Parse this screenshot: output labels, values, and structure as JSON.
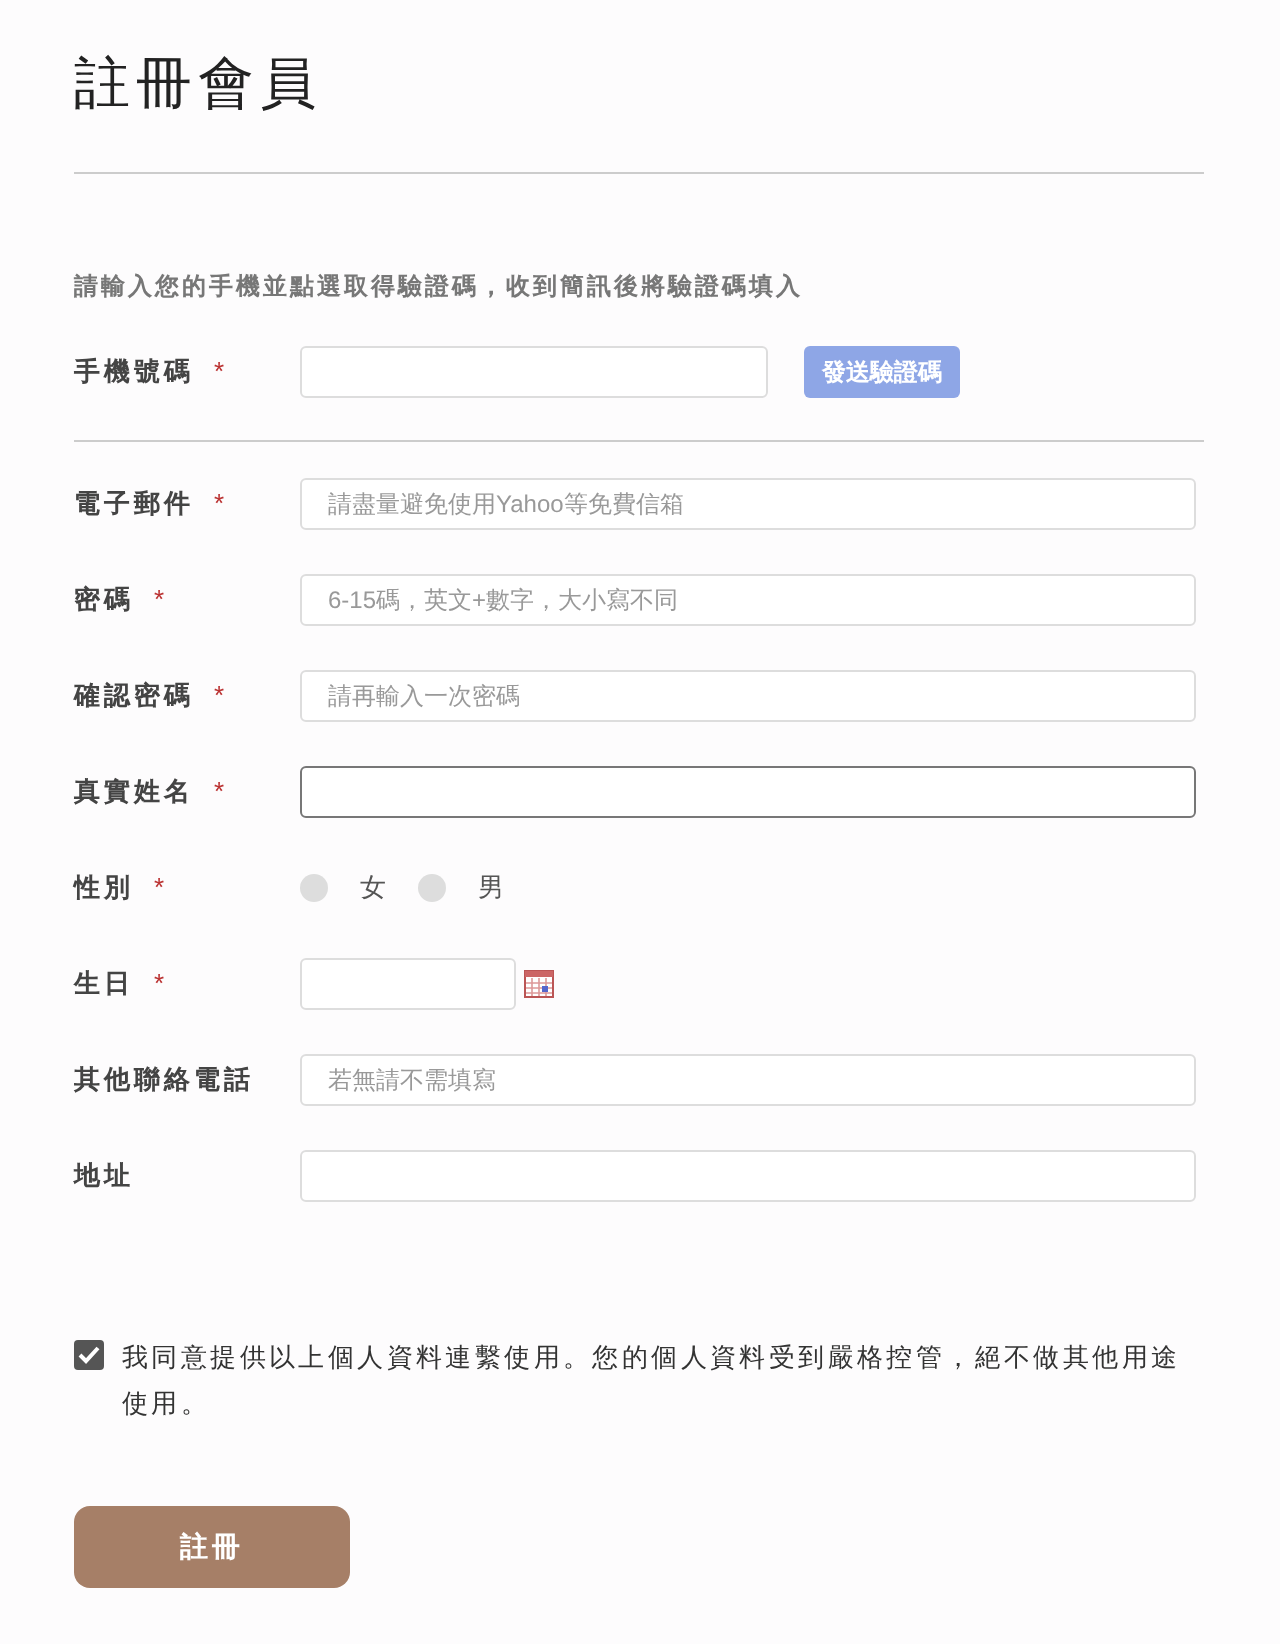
{
  "title": "註冊會員",
  "intro": "請輸入您的手機並點選取得驗證碼，收到簡訊後將驗證碼填入",
  "phone": {
    "label": "手機號碼",
    "mark": "*",
    "button": "發送驗證碼",
    "button_disabled": true
  },
  "fields": [
    {
      "kind": "text",
      "label": "電子郵件",
      "mark": "*",
      "placeholder": "請盡量避免使用Yahoo等免費信箱",
      "focused": false
    },
    {
      "kind": "text",
      "label": "密碼",
      "mark": "*",
      "placeholder": "6-15碼，英文+數字，大小寫不同",
      "focused": false
    },
    {
      "kind": "text",
      "label": "確認密碼",
      "mark": "*",
      "placeholder": "請再輸入一次密碼",
      "focused": false
    },
    {
      "kind": "text",
      "label": "真實姓名",
      "mark": "*",
      "focused": true
    },
    {
      "kind": "radio",
      "label": "性別",
      "mark": "*",
      "options": [
        {
          "label": "女",
          "selected": false
        },
        {
          "label": "男",
          "selected": false
        }
      ]
    },
    {
      "kind": "date",
      "label": "生日",
      "mark": "*"
    },
    {
      "kind": "text",
      "label": "其他聯絡電話",
      "placeholder": "若無請不需填寫",
      "focused": false
    },
    {
      "kind": "text",
      "label": "地址",
      "focused": false
    }
  ],
  "consent": {
    "text": "我同意提供以上個人資料連繫使用。您的個人資料受到嚴格控管，絕不做其他用途使用。",
    "checked": true
  },
  "submit": "註冊"
}
